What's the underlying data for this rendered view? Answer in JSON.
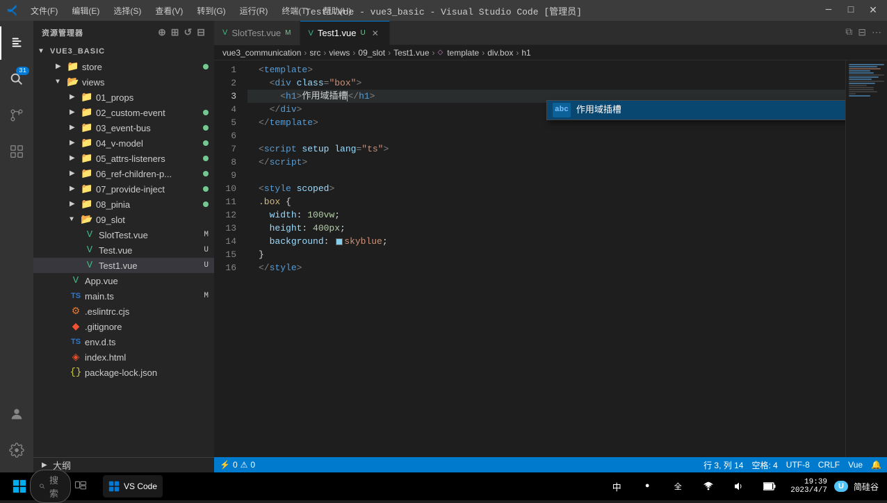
{
  "titlebar": {
    "title": "Test1.vue - vue3_basic - Visual Studio Code [管理员]",
    "menu_items": [
      "文件(F)",
      "编辑(E)",
      "选择(S)",
      "查看(V)",
      "转到(G)",
      "运行(R)",
      "终端(T)",
      "帮助(H)"
    ]
  },
  "tabs": [
    {
      "id": "slottest",
      "label": "SlotTest.vue",
      "modified": "M",
      "active": false
    },
    {
      "id": "test1",
      "label": "Test1.vue",
      "modified": "U",
      "active": true,
      "closable": true
    }
  ],
  "breadcrumb": {
    "items": [
      "vue3_communication",
      "src",
      "views",
      "09_slot",
      "Test1.vue",
      "template",
      "div.box",
      "h1"
    ]
  },
  "sidebar": {
    "title": "资源管理器",
    "root": "VUE3_BASIC",
    "folders": [
      {
        "name": "store",
        "indent": 1,
        "dot": "green"
      },
      {
        "name": "views",
        "indent": 1,
        "expanded": true
      },
      {
        "name": "01_props",
        "indent": 2
      },
      {
        "name": "02_custom-event",
        "indent": 2,
        "dot": "green"
      },
      {
        "name": "03_event-bus",
        "indent": 2,
        "dot": "green"
      },
      {
        "name": "04_v-model",
        "indent": 2,
        "dot": "green"
      },
      {
        "name": "05_attrs-listeners",
        "indent": 2,
        "dot": "green"
      },
      {
        "name": "06_ref-children-p...",
        "indent": 2,
        "dot": "green"
      },
      {
        "name": "07_provide-inject",
        "indent": 2,
        "dot": "green"
      },
      {
        "name": "08_pinia",
        "indent": 2,
        "dot": "green"
      },
      {
        "name": "09_slot",
        "indent": 2,
        "expanded": true
      }
    ],
    "files": [
      {
        "name": "SlotTest.vue",
        "type": "vue",
        "indent": 3,
        "badge": "M"
      },
      {
        "name": "Test.vue",
        "type": "vue",
        "indent": 3,
        "badge": "U"
      },
      {
        "name": "Test1.vue",
        "type": "vue",
        "indent": 3,
        "badge": "U",
        "selected": true
      },
      {
        "name": "App.vue",
        "type": "vue",
        "indent": 2
      },
      {
        "name": "main.ts",
        "type": "ts",
        "indent": 2,
        "badge": "M"
      },
      {
        "name": ".eslintrc.cjs",
        "type": "js",
        "indent": 2
      },
      {
        "name": ".gitignore",
        "type": "git",
        "indent": 2
      },
      {
        "name": "env.d.ts",
        "type": "ts",
        "indent": 2
      },
      {
        "name": "index.html",
        "type": "html",
        "indent": 2
      },
      {
        "name": "package-lock.json",
        "type": "json",
        "indent": 2
      }
    ],
    "bottom_folder": "大纲"
  },
  "editor": {
    "lines": [
      {
        "num": 1,
        "tokens": [
          {
            "t": "tag",
            "v": "<"
          },
          {
            "t": "tagname",
            "v": "template"
          },
          {
            "t": "tag",
            "v": ">"
          }
        ]
      },
      {
        "num": 2,
        "tokens": [
          {
            "t": "tag",
            "v": "  <"
          },
          {
            "t": "tagname",
            "v": "div"
          },
          {
            "t": "attr",
            "v": " class"
          },
          {
            "t": "tag",
            "v": "="
          },
          {
            "t": "string",
            "v": "\"box\""
          },
          {
            "t": "tag",
            "v": ">"
          }
        ]
      },
      {
        "num": 3,
        "tokens": [
          {
            "t": "tag",
            "v": "    <"
          },
          {
            "t": "tagname",
            "v": "h1"
          },
          {
            "t": "tag",
            "v": ">"
          },
          {
            "t": "text",
            "v": "作用域插槽"
          },
          {
            "t": "cursor"
          },
          {
            "t": "tag",
            "v": "</"
          },
          {
            "t": "tagname",
            "v": "h1"
          },
          {
            "t": "tag",
            "v": ">"
          }
        ],
        "active": true
      },
      {
        "num": 4,
        "tokens": [
          {
            "t": "tag",
            "v": "  </"
          },
          {
            "t": "tagname",
            "v": "div"
          },
          {
            "t": "tag",
            "v": ">"
          }
        ]
      },
      {
        "num": 5,
        "tokens": [
          {
            "t": "tag",
            "v": "</"
          },
          {
            "t": "tagname",
            "v": "template"
          },
          {
            "t": "tag",
            "v": ">"
          }
        ]
      },
      {
        "num": 6,
        "tokens": []
      },
      {
        "num": 7,
        "tokens": [
          {
            "t": "tag",
            "v": "<"
          },
          {
            "t": "tagname",
            "v": "script"
          },
          {
            "t": "attr",
            "v": " setup lang"
          },
          {
            "t": "tag",
            "v": "="
          },
          {
            "t": "string",
            "v": "\"ts\""
          },
          {
            "t": "tag",
            "v": ">"
          }
        ]
      },
      {
        "num": 8,
        "tokens": [
          {
            "t": "tag",
            "v": "</"
          },
          {
            "t": "tagname",
            "v": "script"
          },
          {
            "t": "tag",
            "v": ">"
          }
        ]
      },
      {
        "num": 9,
        "tokens": []
      },
      {
        "num": 10,
        "tokens": [
          {
            "t": "tag",
            "v": "<"
          },
          {
            "t": "tagname",
            "v": "style"
          },
          {
            "t": "attr",
            "v": " scoped"
          },
          {
            "t": "tag",
            "v": ">"
          }
        ]
      },
      {
        "num": 11,
        "tokens": [
          {
            "t": "selector",
            "v": ".box"
          },
          {
            "t": "text",
            "v": " {"
          }
        ]
      },
      {
        "num": 12,
        "tokens": [
          {
            "t": "text",
            "v": "  "
          },
          {
            "t": "property",
            "v": "width"
          },
          {
            "t": "text",
            "v": ": "
          },
          {
            "t": "number",
            "v": "100vw"
          },
          {
            "t": "text",
            "v": ";"
          }
        ]
      },
      {
        "num": 13,
        "tokens": [
          {
            "t": "text",
            "v": "  "
          },
          {
            "t": "property",
            "v": "height"
          },
          {
            "t": "text",
            "v": ": "
          },
          {
            "t": "number",
            "v": "400px"
          },
          {
            "t": "text",
            "v": ";"
          }
        ]
      },
      {
        "num": 14,
        "tokens": [
          {
            "t": "text",
            "v": "  "
          },
          {
            "t": "property",
            "v": "background"
          },
          {
            "t": "text",
            "v": ": "
          },
          {
            "t": "swatch"
          },
          {
            "t": "value",
            "v": "skyblue"
          },
          {
            "t": "text",
            "v": ";"
          }
        ]
      },
      {
        "num": 15,
        "tokens": [
          {
            "t": "text",
            "v": "}"
          }
        ]
      },
      {
        "num": 16,
        "tokens": [
          {
            "t": "tag",
            "v": "</"
          },
          {
            "t": "tagname",
            "v": "style"
          },
          {
            "t": "tag",
            "v": ">"
          }
        ]
      }
    ]
  },
  "autocomplete": {
    "items": [
      {
        "icon": "abc",
        "text": "作用域插槽",
        "selected": true
      }
    ]
  },
  "statusbar": {
    "left": [
      "⚡ 0",
      "⚠ 0"
    ],
    "right": [
      "行 3, 列 14",
      "空格: 4",
      "UTF-8",
      "CRLF",
      "Vue"
    ]
  },
  "taskbar": {
    "search_placeholder": "搜索",
    "time": "19:39",
    "date": "2023/4/7",
    "ime": "中",
    "user": "简硅谷"
  }
}
